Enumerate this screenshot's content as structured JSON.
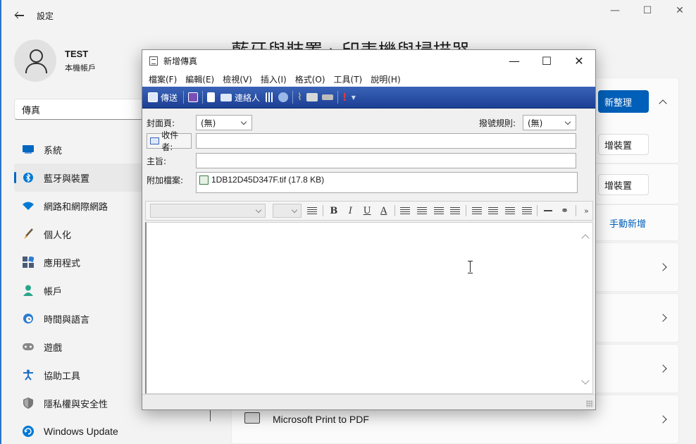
{
  "settings": {
    "title": "設定",
    "profile": {
      "name": "TEST",
      "sub": "本機帳戶"
    },
    "search": "傳真",
    "heading": "藍牙與裝置 › 印表機與掃描器",
    "nav": [
      {
        "label": "系統",
        "icon": "monitor-icon",
        "color": "#0067c0"
      },
      {
        "label": "藍牙與裝置",
        "icon": "bluetooth-icon",
        "color": "#0078d4"
      },
      {
        "label": "網路和網際網路",
        "icon": "wifi-icon",
        "color": "#0078d4"
      },
      {
        "label": "個人化",
        "icon": "brush-icon",
        "color": "#e29b3a"
      },
      {
        "label": "應用程式",
        "icon": "apps-icon",
        "color": "#4a5a78"
      },
      {
        "label": "帳戶",
        "icon": "person-icon",
        "color": "#2aa58c"
      },
      {
        "label": "時間與語言",
        "icon": "globe-clock-icon",
        "color": "#2b7cd3"
      },
      {
        "label": "遊戲",
        "icon": "gamepad-icon",
        "color": "#888888"
      },
      {
        "label": "協助工具",
        "icon": "accessibility-icon",
        "color": "#1f6fc5"
      },
      {
        "label": "隱私權與安全性",
        "icon": "shield-icon",
        "color": "#777777"
      },
      {
        "label": "Windows Update",
        "icon": "update-icon",
        "color": "#0078d4"
      }
    ],
    "buttons": {
      "refresh": "新整理",
      "add_device_1": "增裝置",
      "add_device_2": "增裝置",
      "manual_add": "手動新增"
    },
    "printer": "Microsoft Print to PDF"
  },
  "fax": {
    "title": "新增傳真",
    "menu": [
      "檔案(F)",
      "編輯(E)",
      "檢視(V)",
      "插入(I)",
      "格式(O)",
      "工具(T)",
      "說明(H)"
    ],
    "toolbar": {
      "send": "傳送",
      "contacts": "連絡人"
    },
    "cover_label": "封面頁:",
    "cover_value": "(無)",
    "dial_label": "撥號規則:",
    "dial_value": "(無)",
    "to_label": "收件者:",
    "subject_label": "主旨:",
    "attach_label": "附加檔案:",
    "attachment": "1DB12D45D347F.tif (17.8 KB)"
  }
}
